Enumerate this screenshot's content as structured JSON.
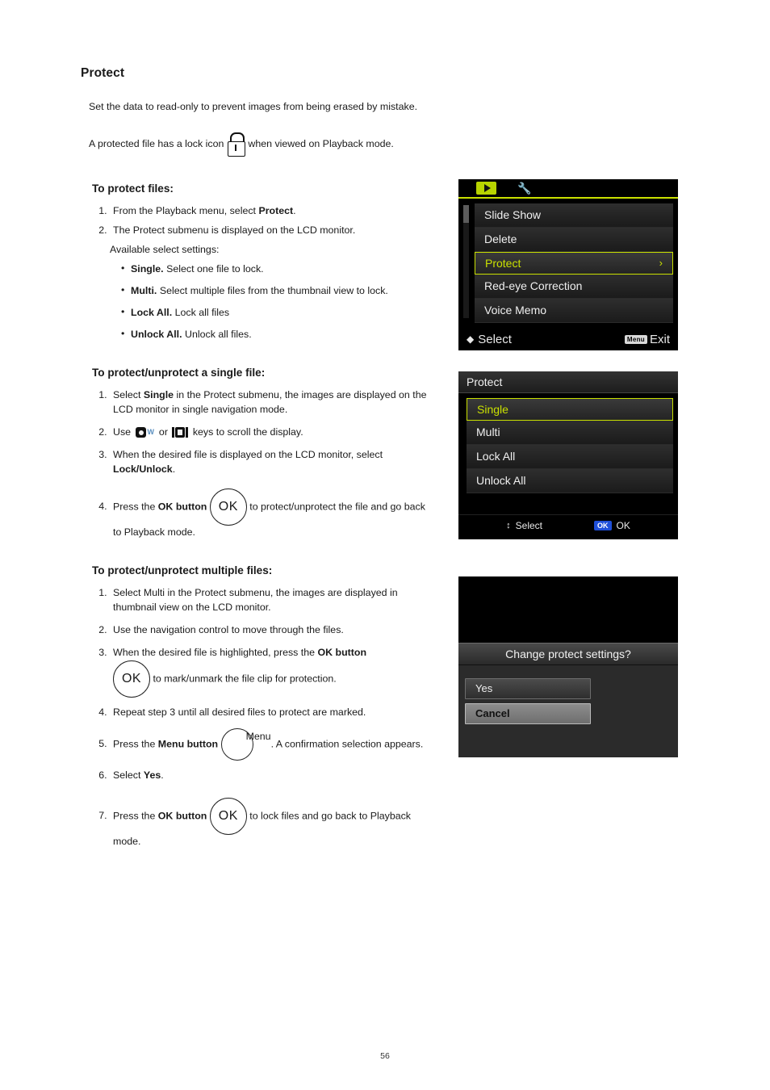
{
  "document": {
    "title": "Protect",
    "intro": "Set the data to read-only to prevent images from being erased by mistake.",
    "intro2_before": "A protected file has a lock icon",
    "intro2_after": "when viewed on Playback mode.",
    "page_number": "56"
  },
  "sections": [
    {
      "heading": "To protect files:",
      "steps": [
        "From the Playback menu, select Protect.",
        "The Protect submenu is displayed on the LCD monitor."
      ],
      "available_label": "Available select settings:",
      "bullets": [
        {
          "term": "Single.",
          "text": "Select one file to lock."
        },
        {
          "term": "Multi.",
          "text": "Select multiple files from the thumbnail view to lock."
        },
        {
          "term": "Lock All.",
          "text": "Lock all files"
        },
        {
          "term": "Unlock All.",
          "text": "Unlock all files."
        }
      ]
    },
    {
      "heading": "To protect/unprotect a single file:",
      "steps": [
        "Select Single in the Protect submenu, the images are displayed on the LCD monitor in single navigation mode.",
        "Use W or T keys to scroll the display.",
        "When the desired file is displayed on the LCD monitor, select Lock/Unlock.",
        "Press the OK button to protect/unprotect the file and go back to Playback mode."
      ]
    },
    {
      "heading": "To protect/unprotect multiple files:",
      "steps": [
        "Select Multi in the Protect submenu, the images are displayed in thumbnail view on the LCD monitor.",
        "Use the navigation control to move through the files.",
        "When the desired file is highlighted, press the OK button to mark/unmark the file clip for protection.",
        "Repeat step 3 until all desired files to protect are marked.",
        "Press the Menu button. A confirmation selection appears.",
        "Select Yes.",
        "Press the OK button to lock files and go back to Playback mode."
      ]
    }
  ],
  "inline_text": {
    "step1_a": "From the Playback menu, select ",
    "step1_b": "Protect",
    "step1_c": ".",
    "step2": "The Protect submenu is displayed on the LCD monitor.",
    "s2_step1_a": "Select ",
    "s2_step1_b": "Single",
    "s2_step1_c": " in the Protect submenu, the images are displayed on the LCD monitor in single navigation mode.",
    "s2_step2_a": "Use ",
    "s2_step2_b": " or ",
    "s2_step2_c": " keys to scroll the display.",
    "s2_step3_a": "When the desired file is displayed on the LCD monitor, select ",
    "s2_step3_b": "Lock/Unlock",
    "s2_step3_c": ".",
    "s2_step4_a": "Press the ",
    "s2_step4_b": "OK button",
    "s2_step4_c": " to protect/unprotect the file and go back to Playback mode.",
    "s3_step1": "Select Multi in the Protect submenu, the images are displayed in thumbnail view on the LCD monitor.",
    "s3_step2": "Use the navigation control to move through the files.",
    "s3_step3_a": "When the desired file is highlighted, press the ",
    "s3_step3_b": "OK button",
    "s3_step3_c": " to mark/unmark the file clip for protection.",
    "s3_step4": "Repeat step 3 until all desired files to protect are marked.",
    "s3_step5_a": "Press the ",
    "s3_step5_b": "Menu button",
    "s3_step5_c": ". A confirmation selection appears.",
    "s3_step6_a": "Select ",
    "s3_step6_b": "Yes",
    "s3_step6_c": ".",
    "s3_step7_a": "Press the ",
    "s3_step7_b": "OK button",
    "s3_step7_c": " to lock files and go back to Playback mode.",
    "ok_label": "OK",
    "menu_label": "Menu"
  },
  "screens": {
    "playback_menu": {
      "tabs": [
        "playback-tab-icon",
        "setup-wrench-icon"
      ],
      "items": [
        {
          "label": "Slide Show",
          "selected": false
        },
        {
          "label": "Delete",
          "selected": false
        },
        {
          "label": "Protect",
          "selected": true,
          "arrow": "›"
        },
        {
          "label": "Red-eye Correction",
          "selected": false
        },
        {
          "label": "Voice Memo",
          "selected": false
        }
      ],
      "footer_select": "Select",
      "footer_menu_chip": "Menu",
      "footer_exit": "Exit"
    },
    "protect_menu": {
      "title": "Protect",
      "items": [
        {
          "label": "Single",
          "selected": true
        },
        {
          "label": "Multi",
          "selected": false
        },
        {
          "label": "Lock All",
          "selected": false
        },
        {
          "label": "Unlock All",
          "selected": false
        }
      ],
      "footer_select": "Select",
      "footer_ok_chip": "OK",
      "footer_ok": "OK"
    },
    "confirm_dialog": {
      "message": "Change protect settings?",
      "buttons": [
        {
          "label": "Yes",
          "selected": false
        },
        {
          "label": "Cancel",
          "selected": true
        }
      ]
    }
  },
  "colors": {
    "accent": "#c9e000",
    "screen_bg": "#000000",
    "ok_chip": "#1f4fd8"
  }
}
